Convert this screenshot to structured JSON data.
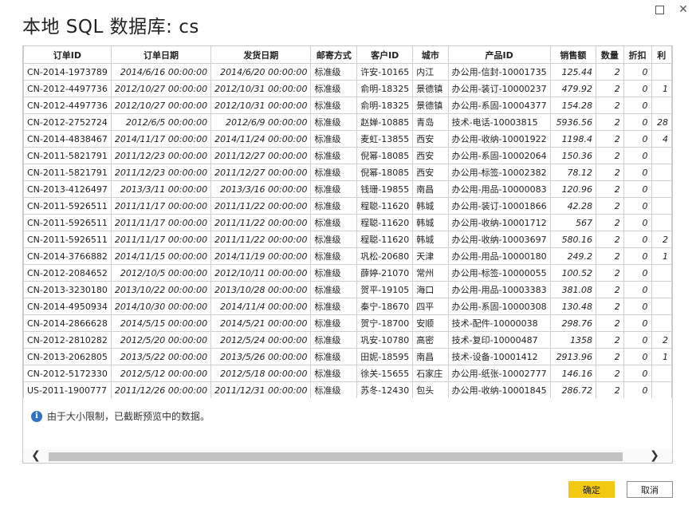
{
  "window": {
    "title": "本地 SQL 数据库: cs",
    "maximize_label": "",
    "close_label": "✕"
  },
  "table": {
    "columns": [
      "订单ID",
      "订单日期",
      "发货日期",
      "邮寄方式",
      "客户ID",
      "城市",
      "产品ID",
      "销售额",
      "数量",
      "折扣",
      "利"
    ],
    "rows": [
      [
        "CN-2014-1973789",
        "2014/6/16 00:00:00",
        "2014/6/20 00:00:00",
        "标准级",
        "许安-10165",
        "内江",
        "办公用-信封-10001735",
        "125.44",
        "2",
        "0",
        ""
      ],
      [
        "CN-2012-4497736",
        "2012/10/27 00:00:00",
        "2012/10/31 00:00:00",
        "标准级",
        "俞明-18325",
        "景德镇",
        "办公用-装订-10000237",
        "479.92",
        "2",
        "0",
        "1"
      ],
      [
        "CN-2012-4497736",
        "2012/10/27 00:00:00",
        "2012/10/31 00:00:00",
        "标准级",
        "俞明-18325",
        "景德镇",
        "办公用-系固-10004377",
        "154.28",
        "2",
        "0",
        ""
      ],
      [
        "CN-2012-2752724",
        "2012/6/5 00:00:00",
        "2012/6/9 00:00:00",
        "标准级",
        "赵婵-10885",
        "青岛",
        "技术-电话-10003815",
        "5936.56",
        "2",
        "0",
        "28"
      ],
      [
        "CN-2014-4838467",
        "2014/11/17 00:00:00",
        "2014/11/24 00:00:00",
        "标准级",
        "麦虹-13855",
        "西安",
        "办公用-收纳-10001922",
        "1198.4",
        "2",
        "0",
        "4"
      ],
      [
        "CN-2011-5821791",
        "2011/12/23 00:00:00",
        "2011/12/27 00:00:00",
        "标准级",
        "倪幂-18085",
        "西安",
        "办公用-系固-10002064",
        "150.36",
        "2",
        "0",
        ""
      ],
      [
        "CN-2011-5821791",
        "2011/12/23 00:00:00",
        "2011/12/27 00:00:00",
        "标准级",
        "倪幂-18085",
        "西安",
        "办公用-标签-10002382",
        "78.12",
        "2",
        "0",
        ""
      ],
      [
        "CN-2013-4126497",
        "2013/3/11 00:00:00",
        "2013/3/16 00:00:00",
        "标准级",
        "钱珊-19855",
        "南昌",
        "办公用-用品-10000083",
        "120.96",
        "2",
        "0",
        ""
      ],
      [
        "CN-2011-5926511",
        "2011/11/17 00:00:00",
        "2011/11/22 00:00:00",
        "标准级",
        "程聪-11620",
        "韩城",
        "办公用-装订-10001866",
        "42.28",
        "2",
        "0",
        ""
      ],
      [
        "CN-2011-5926511",
        "2011/11/17 00:00:00",
        "2011/11/22 00:00:00",
        "标准级",
        "程聪-11620",
        "韩城",
        "办公用-收纳-10001712",
        "567",
        "2",
        "0",
        ""
      ],
      [
        "CN-2011-5926511",
        "2011/11/17 00:00:00",
        "2011/11/22 00:00:00",
        "标准级",
        "程聪-11620",
        "韩城",
        "办公用-收纳-10003697",
        "580.16",
        "2",
        "0",
        "2"
      ],
      [
        "CN-2014-3766882",
        "2014/11/15 00:00:00",
        "2014/11/19 00:00:00",
        "标准级",
        "巩松-20680",
        "天津",
        "办公用-用品-10000180",
        "249.2",
        "2",
        "0",
        "1"
      ],
      [
        "CN-2012-2084652",
        "2012/10/5 00:00:00",
        "2012/10/11 00:00:00",
        "标准级",
        "薛婷-21070",
        "常州",
        "办公用-标签-10000055",
        "100.52",
        "2",
        "0",
        ""
      ],
      [
        "CN-2013-3230180",
        "2013/10/22 00:00:00",
        "2013/10/28 00:00:00",
        "标准级",
        "贺平-19105",
        "海口",
        "办公用-用品-10003383",
        "381.08",
        "2",
        "0",
        ""
      ],
      [
        "CN-2014-4950934",
        "2014/10/30 00:00:00",
        "2014/11/4 00:00:00",
        "标准级",
        "秦宁-18670",
        "四平",
        "办公用-系固-10000308",
        "130.48",
        "2",
        "0",
        ""
      ],
      [
        "CN-2014-2866628",
        "2014/5/15 00:00:00",
        "2014/5/21 00:00:00",
        "标准级",
        "贺宁-18700",
        "安顺",
        "技术-配件-10000038",
        "298.76",
        "2",
        "0",
        ""
      ],
      [
        "CN-2012-2810282",
        "2012/5/20 00:00:00",
        "2012/5/24 00:00:00",
        "标准级",
        "巩安-10780",
        "高密",
        "技术-复印-10000487",
        "1358",
        "2",
        "0",
        "2"
      ],
      [
        "CN-2013-2062805",
        "2013/5/22 00:00:00",
        "2013/5/26 00:00:00",
        "标准级",
        "田妮-18595",
        "南昌",
        "技术-设备-10001412",
        "2913.96",
        "2",
        "0",
        "1"
      ],
      [
        "CN-2012-5172330",
        "2012/5/12 00:00:00",
        "2012/5/18 00:00:00",
        "标准级",
        "徐关-15655",
        "石家庄",
        "办公用-纸张-10002777",
        "146.16",
        "2",
        "0",
        ""
      ],
      [
        "US-2011-1900777",
        "2011/12/26 00:00:00",
        "2011/12/31 00:00:00",
        "标准级",
        "苏冬-12430",
        "包头",
        "办公用-收纳-10001845",
        "286.72",
        "2",
        "0",
        ""
      ]
    ]
  },
  "notice": {
    "icon": "info-icon",
    "text": "由于大小限制，已截断预览中的数据。"
  },
  "scrollbar": {
    "left_arrow": "❮",
    "right_arrow": "❯"
  },
  "buttons": {
    "ok_label": "确定",
    "cancel_label": "取消"
  },
  "colors": {
    "ok_button": "#f2c811",
    "info_icon": "#2f72c4"
  }
}
